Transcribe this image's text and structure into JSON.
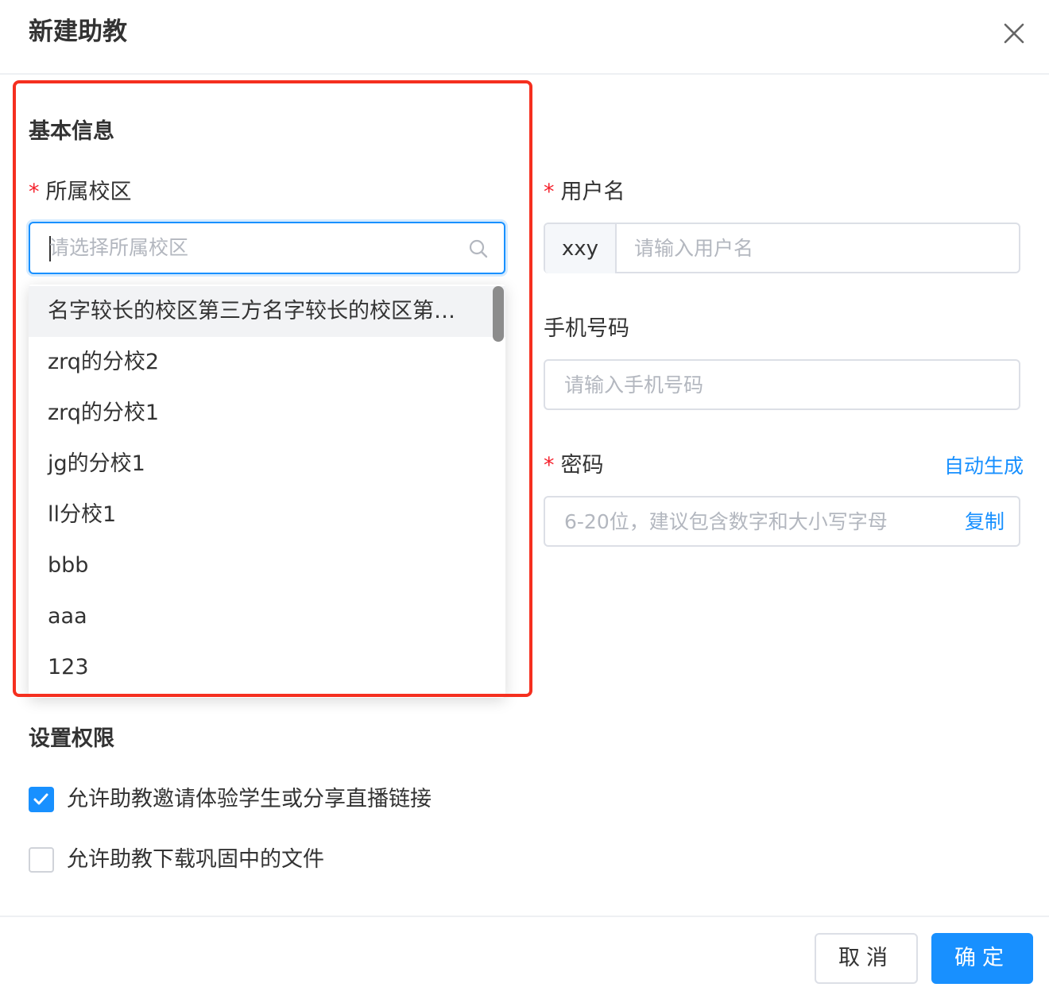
{
  "dialog": {
    "title": "新建助教",
    "close_icon": "close-icon"
  },
  "basic_info": {
    "section_title": "基本信息",
    "campus": {
      "required_mark": "*",
      "label": "所属校区",
      "placeholder": "请选择所属校区",
      "icon": "search-icon",
      "options": [
        "名字较长的校区第三方名字较长的校区第三方",
        "zrq的分校2",
        "zrq的分校1",
        "jg的分校1",
        "ll分校1",
        "bbb",
        "aaa",
        "123"
      ],
      "highlighted_index": 0
    },
    "username": {
      "required_mark": "*",
      "label": "用户名",
      "prefix": "xxy",
      "placeholder": "请输入用户名"
    },
    "phone": {
      "label": "手机号码",
      "placeholder": "请输入手机号码"
    },
    "password": {
      "required_mark": "*",
      "label": "密码",
      "auto_generate": "自动生成",
      "placeholder": "6-20位，建议包含数字和大小写字母",
      "copy": "复制"
    }
  },
  "permissions": {
    "section_title": "设置权限",
    "items": [
      {
        "label": "允许助教邀请体验学生或分享直播链接",
        "checked": true
      },
      {
        "label": "允许助教下载巩固中的文件",
        "checked": false
      }
    ]
  },
  "footer": {
    "cancel": "取消",
    "confirm": "确定"
  },
  "colors": {
    "primary": "#1890ff",
    "required": "#f5222d",
    "annotation_box": "#f52f1f"
  }
}
